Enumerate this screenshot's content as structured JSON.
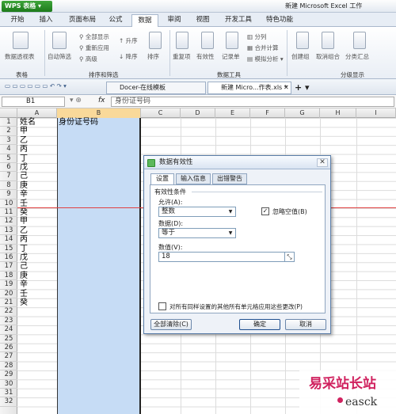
{
  "titlebar": {
    "app": "WPS 表格",
    "title": "新建 Microsoft Excel 工作"
  },
  "menu_tabs": [
    "开始",
    "插入",
    "页面布局",
    "公式",
    "数据",
    "审阅",
    "视图",
    "开发工具",
    "特色功能"
  ],
  "ribbon": {
    "groups": [
      "表格",
      "排序和筛选",
      "数据工具",
      "分级显示"
    ],
    "items": {
      "pivot": "数据透视表",
      "autofilter": "自动筛选",
      "show_all": "全部显示",
      "reapply": "重新应用",
      "advanced": "高级",
      "sort_asc": "升序",
      "sort_desc": "降序",
      "sort": "排序",
      "duplicates": "重复项",
      "validity": "有效性",
      "record": "记录单",
      "split": "分列",
      "consolidate": "合并计算",
      "whatif": "模拟分析",
      "group": "创建组",
      "ungroup": "取消组合",
      "subtotal": "分类汇总"
    }
  },
  "doc_tabs": [
    "Docer-在线模板",
    "新建 Micro...作表.xls *"
  ],
  "formula_bar": {
    "cell_ref": "B1",
    "fx": "fx",
    "content": "身份证号码"
  },
  "grid": {
    "columns": [
      "A",
      "B",
      "C",
      "D",
      "E",
      "F",
      "G",
      "H",
      "I"
    ],
    "rows": [
      "1",
      "2",
      "3",
      "4",
      "5",
      "6",
      "7",
      "8",
      "9",
      "10",
      "11",
      "12",
      "13",
      "14",
      "15",
      "16",
      "17",
      "18",
      "19",
      "20",
      "21",
      "22",
      "23",
      "24",
      "25",
      "26",
      "27",
      "28",
      "29",
      "30",
      "31",
      "32"
    ],
    "colA": [
      "姓名",
      "甲",
      "乙",
      "丙",
      "丁",
      "戊",
      "己",
      "庚",
      "辛",
      "壬",
      "癸",
      "甲",
      "乙",
      "丙",
      "丁",
      "戊",
      "己",
      "庚",
      "辛",
      "壬",
      "癸"
    ],
    "b1": "身份证号码"
  },
  "dialog": {
    "title": "数据有效性",
    "tabs": [
      "设置",
      "输入信息",
      "出错警告"
    ],
    "section": "有效性条件",
    "allow_label": "允许(A):",
    "allow_value": "整数",
    "ignore_blank": "忽略空值(B)",
    "ignore_checked": true,
    "data_label": "数据(D):",
    "data_value": "等于",
    "value_label": "数值(V):",
    "value": "18",
    "apply_all": "对所有同样设置的其他所有单元格应用这些更改(P)",
    "clear_all": "全部清除(C)",
    "ok": "确定",
    "cancel": "取消"
  },
  "watermark": {
    "text": "易采站长站",
    "sub": "easck"
  }
}
